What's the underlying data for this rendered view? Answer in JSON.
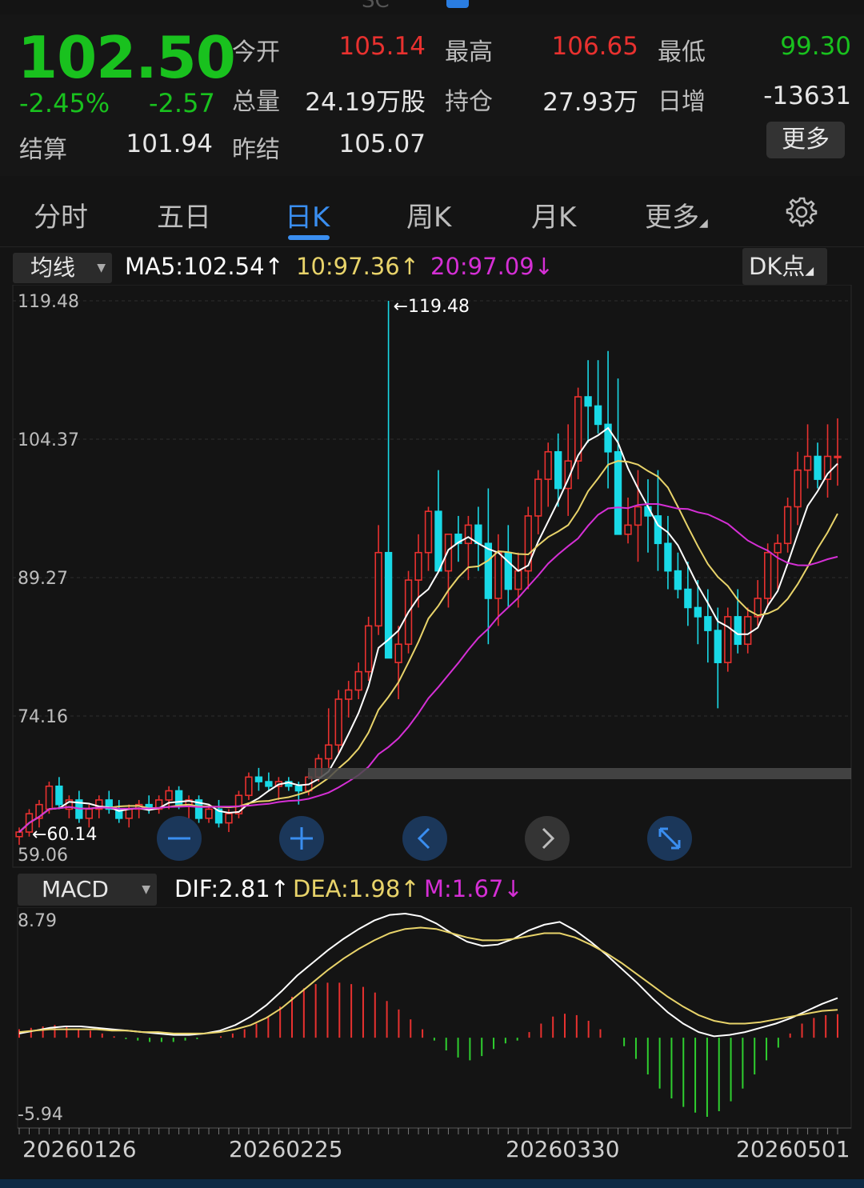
{
  "header": {
    "code": "SC"
  },
  "quote": {
    "price": "102.50",
    "change_pct": "-2.45%",
    "change": "-2.57",
    "open_label": "今开",
    "open": "105.14",
    "high_label": "最高",
    "high": "106.65",
    "low_label": "最低",
    "low": "99.30",
    "volume_label": "总量",
    "volume": "24.19万股",
    "oi_label": "持仓",
    "oi": "27.93万",
    "daily_inc_label": "日增",
    "daily_inc": "-13631",
    "settle_label": "结算",
    "settle": "101.94",
    "prev_settle_label": "昨结",
    "prev_settle": "105.07",
    "more_label": "更多"
  },
  "tabs": [
    "分时",
    "五日",
    "日K",
    "周K",
    "月K",
    "更多"
  ],
  "active_tab": "日K",
  "ma": {
    "select": "均线",
    "ma5": "MA5:102.54↑",
    "ma10": "10:97.36↑",
    "ma20": "20:97.09↓",
    "dk": "DK点"
  },
  "macd": {
    "select": "MACD",
    "dif": "DIF:2.81↑",
    "dea": "DEA:1.98↑",
    "m": "M:1.67↓"
  },
  "colors": {
    "up": "#e8312f",
    "down": "#19d9e6",
    "ma5": "#ffffff",
    "ma10": "#e8d36a",
    "ma20": "#d52fd5",
    "macd_pos": "#e8312f",
    "macd_neg": "#2fcf2f"
  },
  "chart_data": [
    {
      "type": "candlestick",
      "y_ticks": [
        "119.48",
        "104.37",
        "89.27",
        "74.16",
        "59.06"
      ],
      "ylim": [
        59.06,
        119.48
      ],
      "max_marker": "←119.48",
      "min_marker": "←60.14",
      "x_tick_labels": [
        "20260126",
        "20260225",
        "20260330",
        "20260501"
      ],
      "candles": [
        [
          61,
          62,
          60.1,
          61.5
        ],
        [
          61.5,
          64,
          61,
          63.5
        ],
        [
          63,
          65,
          62,
          64.5
        ],
        [
          64,
          67,
          63.5,
          66.5
        ],
        [
          66.5,
          67.5,
          64,
          64.5
        ],
        [
          64,
          65.5,
          63,
          65
        ],
        [
          65,
          66,
          62.5,
          63
        ],
        [
          63,
          64.5,
          62,
          64
        ],
        [
          64,
          65.5,
          63,
          65
        ],
        [
          65,
          66,
          63.5,
          64
        ],
        [
          64,
          65,
          62.5,
          63
        ],
        [
          63,
          64.5,
          62,
          64
        ],
        [
          64,
          65,
          63,
          64.5
        ],
        [
          64.5,
          65.5,
          63.5,
          64
        ],
        [
          64,
          65.5,
          63.5,
          65
        ],
        [
          65,
          66.5,
          64,
          66
        ],
        [
          66,
          66.5,
          64,
          64.5
        ],
        [
          64.5,
          65.5,
          63,
          65
        ],
        [
          65,
          65.5,
          62.5,
          63
        ],
        [
          63,
          64.5,
          62.5,
          64
        ],
        [
          64,
          65,
          62,
          62.5
        ],
        [
          62.5,
          64,
          61.5,
          63.5
        ],
        [
          63.5,
          66,
          63,
          65.5
        ],
        [
          65.5,
          68,
          65,
          67.5
        ],
        [
          67.5,
          68.5,
          66,
          67
        ],
        [
          67,
          68,
          66,
          66.5
        ],
        [
          66.5,
          67.5,
          65,
          67
        ],
        [
          67,
          67.5,
          66,
          66.5
        ],
        [
          66.5,
          67,
          64.5,
          66
        ],
        [
          66,
          68,
          65.5,
          67.5
        ],
        [
          67.5,
          70,
          67,
          69.5
        ],
        [
          69.5,
          75,
          68.5,
          71
        ],
        [
          71,
          77,
          70,
          76
        ],
        [
          76,
          78,
          74,
          77
        ],
        [
          77,
          80,
          76,
          79
        ],
        [
          79,
          85,
          78,
          84
        ],
        [
          84,
          95,
          83,
          92
        ],
        [
          92,
          119.48,
          82,
          80.5
        ],
        [
          80,
          84,
          76,
          82
        ],
        [
          82,
          90,
          81,
          89
        ],
        [
          89,
          94,
          86,
          92
        ],
        [
          92,
          97,
          90,
          96.5
        ],
        [
          96.5,
          101,
          92,
          90
        ],
        [
          90,
          92,
          86,
          94
        ],
        [
          94,
          96,
          91,
          93
        ],
        [
          93,
          96,
          89,
          95
        ],
        [
          95,
          97,
          90,
          93
        ],
        [
          93,
          99,
          82,
          87
        ],
        [
          87,
          94,
          84,
          92
        ],
        [
          92,
          95,
          86,
          88
        ],
        [
          88,
          92,
          86,
          90
        ],
        [
          90,
          97,
          88,
          96
        ],
        [
          96,
          101,
          94,
          100
        ],
        [
          100,
          104,
          97,
          103
        ],
        [
          103,
          105,
          97,
          99
        ],
        [
          99,
          106,
          96,
          102
        ],
        [
          102,
          110,
          100,
          109
        ],
        [
          109,
          113,
          104,
          108
        ],
        [
          108,
          113,
          105,
          106
        ],
        [
          106,
          114,
          99,
          103
        ],
        [
          103,
          111,
          97,
          94
        ],
        [
          94,
          98,
          93,
          95
        ],
        [
          95,
          101,
          91,
          97
        ],
        [
          97,
          100,
          92,
          96
        ],
        [
          96,
          101,
          90,
          93
        ],
        [
          93,
          96,
          88,
          90
        ],
        [
          90,
          92,
          87,
          88
        ],
        [
          88,
          91,
          84,
          86
        ],
        [
          86,
          89,
          82,
          85
        ],
        [
          85,
          88,
          80,
          83.5
        ],
        [
          83.5,
          86,
          75,
          80
        ],
        [
          80,
          86,
          79,
          85
        ],
        [
          85,
          88,
          81,
          82
        ],
        [
          82,
          86,
          81,
          85
        ],
        [
          85,
          89,
          84,
          87
        ],
        [
          87,
          93,
          86,
          92
        ],
        [
          92,
          94,
          88,
          93
        ],
        [
          93,
          98,
          92,
          97
        ],
        [
          97,
          103,
          95,
          101
        ],
        [
          101,
          106,
          99,
          102.5
        ],
        [
          102.5,
          104,
          99,
          100
        ],
        [
          100,
          106,
          98,
          102.5
        ],
        [
          102.5,
          106.65,
          99.3,
          102.5
        ]
      ],
      "ma_lines": [
        "MA5",
        "MA10",
        "MA20"
      ]
    },
    {
      "type": "bar",
      "name": "MACD",
      "y_ticks": [
        "8.79",
        "-5.94"
      ],
      "ylim": [
        -5.94,
        8.79
      ],
      "histogram": [
        0.6,
        0.7,
        0.8,
        0.9,
        0.8,
        0.6,
        0.5,
        0.3,
        0.1,
        -0.1,
        -0.2,
        -0.3,
        -0.3,
        -0.3,
        -0.2,
        -0.1,
        0,
        0.1,
        0.3,
        0.6,
        1.0,
        1.5,
        2.2,
        2.9,
        3.5,
        3.8,
        3.9,
        3.9,
        3.8,
        3.6,
        3.2,
        2.6,
        2.0,
        1.3,
        0.6,
        -0.2,
        -0.9,
        -1.4,
        -1.6,
        -1.3,
        -0.8,
        -0.4,
        -0.2,
        0.4,
        1.0,
        1.5,
        1.7,
        1.6,
        1.2,
        0.6,
        0.0,
        -0.6,
        -1.5,
        -2.6,
        -3.6,
        -4.3,
        -4.9,
        -5.3,
        -5.6,
        -5.2,
        -4.5,
        -3.6,
        -2.6,
        -1.6,
        -0.7,
        0.3,
        1.0,
        1.4,
        1.6,
        1.67
      ],
      "dif": [
        0.3,
        0.5,
        0.7,
        0.8,
        0.8,
        0.7,
        0.6,
        0.5,
        0.4,
        0.3,
        0.2,
        0.2,
        0.3,
        0.5,
        0.9,
        1.5,
        2.3,
        3.3,
        4.4,
        5.3,
        6.2,
        7.0,
        7.7,
        8.3,
        8.7,
        8.79,
        8.6,
        8.1,
        7.4,
        6.8,
        6.5,
        6.6,
        7.0,
        7.6,
        8.0,
        8.2,
        7.6,
        6.8,
        5.9,
        4.9,
        3.9,
        2.8,
        1.8,
        1.0,
        0.4,
        0.1,
        0.2,
        0.4,
        0.7,
        1.0,
        1.4,
        1.9,
        2.4,
        2.81
      ],
      "dea": [
        0.4,
        0.5,
        0.6,
        0.6,
        0.6,
        0.6,
        0.5,
        0.5,
        0.4,
        0.4,
        0.3,
        0.3,
        0.3,
        0.4,
        0.6,
        0.9,
        1.4,
        2.1,
        3.0,
        3.9,
        4.8,
        5.6,
        6.3,
        6.9,
        7.4,
        7.7,
        7.8,
        7.7,
        7.4,
        7.1,
        6.9,
        6.9,
        7.0,
        7.2,
        7.4,
        7.4,
        7.1,
        6.6,
        6.0,
        5.3,
        4.5,
        3.7,
        2.9,
        2.2,
        1.6,
        1.2,
        1.0,
        1.0,
        1.1,
        1.3,
        1.5,
        1.7,
        1.9,
        1.98
      ]
    }
  ]
}
